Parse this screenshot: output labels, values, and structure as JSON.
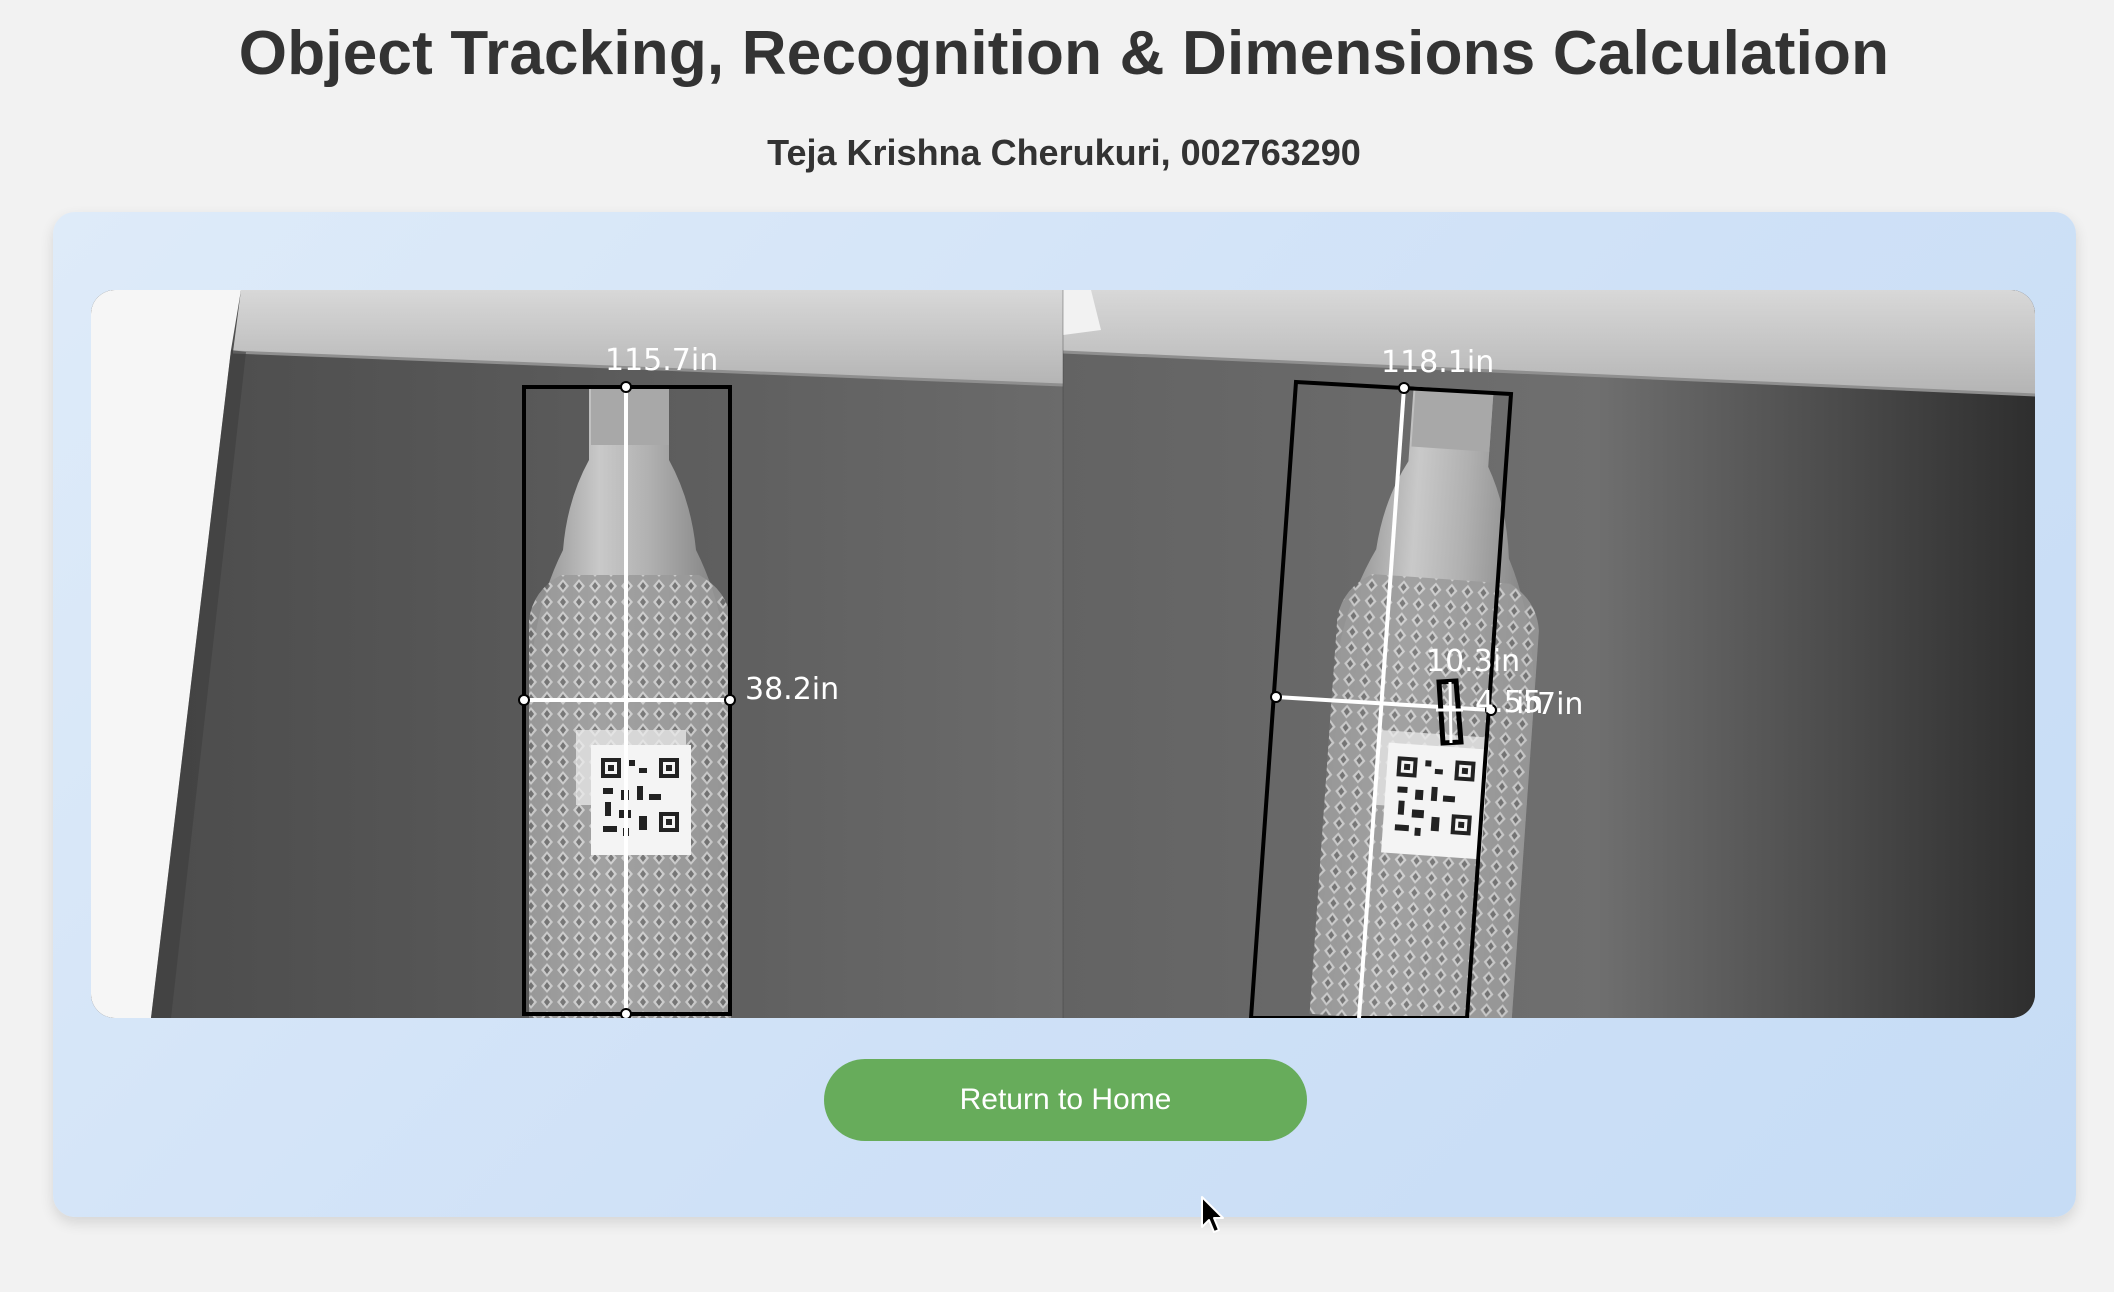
{
  "header": {
    "title": "Object Tracking, Recognition & Dimensions Calculation",
    "subtitle": "Teja Krishna Cherukuri, 002763290"
  },
  "feed": {
    "left_frame": {
      "height_label": "115.7in",
      "width_label": "38.2in"
    },
    "right_frame": {
      "height_label": "118.1in",
      "width_label": "10.3in",
      "small_label_a": "4.55",
      "small_label_b": "in",
      "small_label_c": "7in"
    }
  },
  "actions": {
    "return_home_label": "Return to Home"
  },
  "colors": {
    "page_bg": "#f2f2f2",
    "title_text": "#333333",
    "button_bg": "#67ac5b",
    "panel_bg": "#d4e5f8"
  }
}
